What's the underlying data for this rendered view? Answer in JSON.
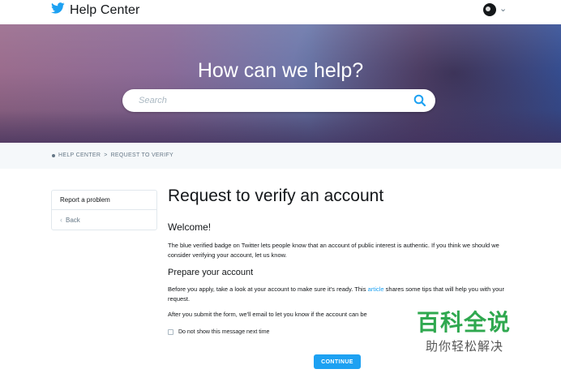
{
  "header": {
    "brand_text": "Help Center",
    "brand_icon": "twitter-bird-icon",
    "language_icon": "globe-icon"
  },
  "hero": {
    "title": "How can we help?",
    "search_placeholder": "Search"
  },
  "breadcrumb": {
    "home": "HELP CENTER",
    "separator": ">",
    "current": "REQUEST TO VERIFY"
  },
  "sidebar": {
    "items": [
      {
        "label": "Report a problem"
      },
      {
        "label": "Back"
      }
    ]
  },
  "main": {
    "title": "Request to verify an account",
    "welcome_heading": "Welcome!",
    "intro": "The blue verified badge on Twitter lets people know that an account of public interest is authentic. If you think we should we consider verifying your account, let us know.",
    "prepare_heading": "Prepare your account",
    "prepare_text_before": "Before you apply, take a look at your account to make sure it's ready. This ",
    "prepare_link": "article",
    "prepare_text_after": " shares some tips that will help you with your request.",
    "after_submit": "After you submit the form, we'll email to let you know if the account can be",
    "checkbox_label": "Do not show this message next time",
    "continue_label": "CONTINUE"
  },
  "watermark": {
    "line1": "百科全说",
    "line2": "助你轻松解决"
  },
  "colors": {
    "accent": "#1da1f2",
    "text": "#14171a",
    "muted": "#657786",
    "crumb_bg": "#f5f8fa",
    "watermark_green": "#2fa84f"
  }
}
